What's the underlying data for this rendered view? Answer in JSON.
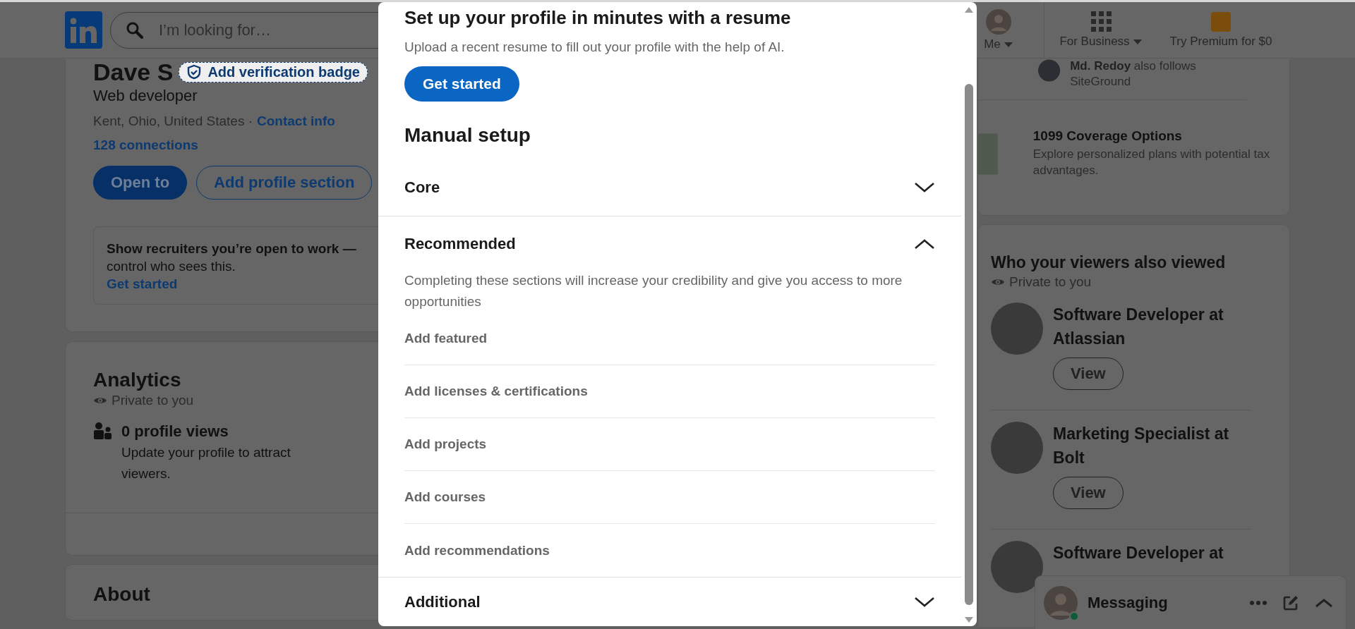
{
  "header": {
    "search": {
      "placeholder": "I’m looking for…"
    },
    "nav": [
      {
        "label": "Me",
        "kind": "avatar",
        "dropdown": true
      },
      {
        "label": "For Business",
        "kind": "grid",
        "dropdown": true
      },
      {
        "label": "Try Premium for $0",
        "kind": "premium",
        "dropdown": false
      }
    ]
  },
  "profile": {
    "name": "Dave S",
    "verification": "Add verification badge",
    "headline": "Web developer",
    "location": "Kent, Ohio, United States ·",
    "contact": "Contact info",
    "connections": "128 connections",
    "buttons": [
      {
        "label": "Open to",
        "kind": "primary"
      },
      {
        "label": "Add profile section",
        "kind": "secondary"
      }
    ],
    "open_to_work": {
      "lead": "Show recruiters you’re open to work —",
      "rest": "control who sees this.",
      "link": "Get started"
    }
  },
  "analytics": {
    "title": "Analytics",
    "privacy": "Private to you",
    "views": "0 profile views",
    "description": "Update your profile to attract viewers."
  },
  "about": {
    "title": "About"
  },
  "right_rail": {
    "follow": "**Md. Redoy** also follows SiteGround",
    "ad": {
      "title": "1099 Coverage Options",
      "description": "Explore personalized plans with potential tax advantages."
    },
    "viewers": {
      "title": "Who your viewers also viewed",
      "privacy": "Private to you",
      "people": [
        {
          "title": "Software Developer at Atlassian",
          "button": "View"
        },
        {
          "title": "Marketing Specialist at Bolt",
          "button": "View"
        },
        {
          "title": "Software Developer at"
        }
      ]
    }
  },
  "messaging": {
    "label": "Messaging",
    "online": true
  },
  "modal": {
    "title": "Set up your profile in minutes with a resume",
    "subtitle": "Upload a recent resume to fill out your profile with the help of AI.",
    "button": "Get started",
    "section_title": "Manual setup",
    "sections": [
      {
        "title": "Core",
        "expanded": false
      },
      {
        "title": "Recommended",
        "expanded": true,
        "description": "Completing these sections will increase your credibility and give you access to more opportunities",
        "items": [
          "Add featured",
          "Add licenses & certifications",
          "Add projects",
          "Add courses",
          "Add recommendations"
        ]
      },
      {
        "title": "Additional",
        "expanded": false
      }
    ]
  }
}
